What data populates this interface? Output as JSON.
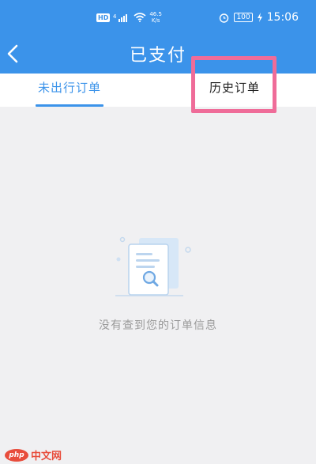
{
  "status_bar": {
    "hd": "HD",
    "net_speed_value": "46.5",
    "net_speed_unit": "K/s",
    "battery": "100",
    "time": "15:06",
    "icons": [
      "signal-icon",
      "wifi-icon",
      "alarm-icon",
      "battery-icon",
      "charging-icon"
    ]
  },
  "header": {
    "title": "已支付",
    "back_icon": "chevron-left-icon"
  },
  "tabs": [
    {
      "label": "未出行订单",
      "active": true
    },
    {
      "label": "历史订单",
      "active": false
    }
  ],
  "empty_state": {
    "icon": "document-search-icon",
    "message": "没有查到您的订单信息"
  },
  "watermark": {
    "logo": "php",
    "text": "中文网"
  },
  "colors": {
    "primary": "#3b93ea",
    "highlight": "#ef6c99",
    "background": "#f0f0f2",
    "muted_text": "#9a9a9a"
  }
}
